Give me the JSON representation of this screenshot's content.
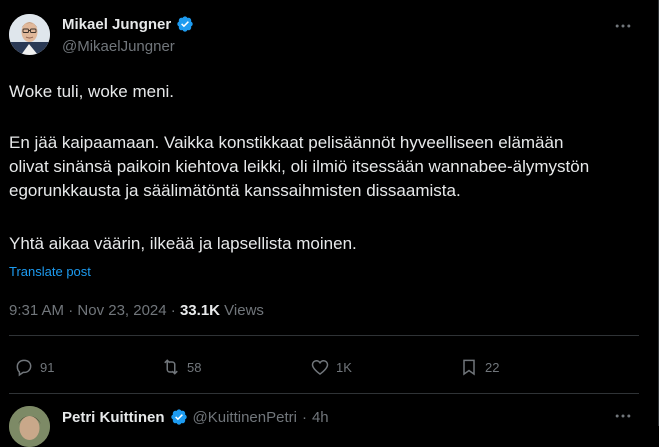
{
  "author": {
    "name": "Mikael Jungner",
    "handle": "@MikaelJungner",
    "verified": true
  },
  "tweet": {
    "paragraphs": [
      "Woke tuli, woke meni.",
      "En jää kaipaamaan. Vaikka konstikkaat pelisäännöt hyveelliseen elämään olivat sinänsä paikoin kiehtova leikki, oli ilmiö itsessään wannabee-älymystön egorunkkausta ja säälimätöntä kanssaihmisten dissaamista.",
      "Yhtä aikaa väärin, ilkeää ja lapsellista moinen."
    ],
    "translate_label": "Translate post",
    "time": "9:31 AM",
    "dot": "·",
    "date": "Nov 23, 2024",
    "views_count": "33.1K",
    "views_label": "Views"
  },
  "actions": {
    "replies": "91",
    "reposts": "58",
    "likes": "1K",
    "bookmarks": "22"
  },
  "reply": {
    "name": "Petri Kuittinen",
    "handle": "@KuittinenPetri",
    "dot": "·",
    "time": "4h"
  },
  "colors": {
    "background": "#000000",
    "text": "#e7e9ea",
    "muted": "#71767b",
    "link": "#1d9bf0",
    "verified": "#1d9bf0",
    "border": "#2f3336"
  },
  "icons": {
    "verified": "verified-badge-icon",
    "more": "more-dots-icon",
    "reply": "reply-bubble-icon",
    "repost": "repost-icon",
    "like": "heart-icon",
    "bookmark": "bookmark-icon"
  }
}
